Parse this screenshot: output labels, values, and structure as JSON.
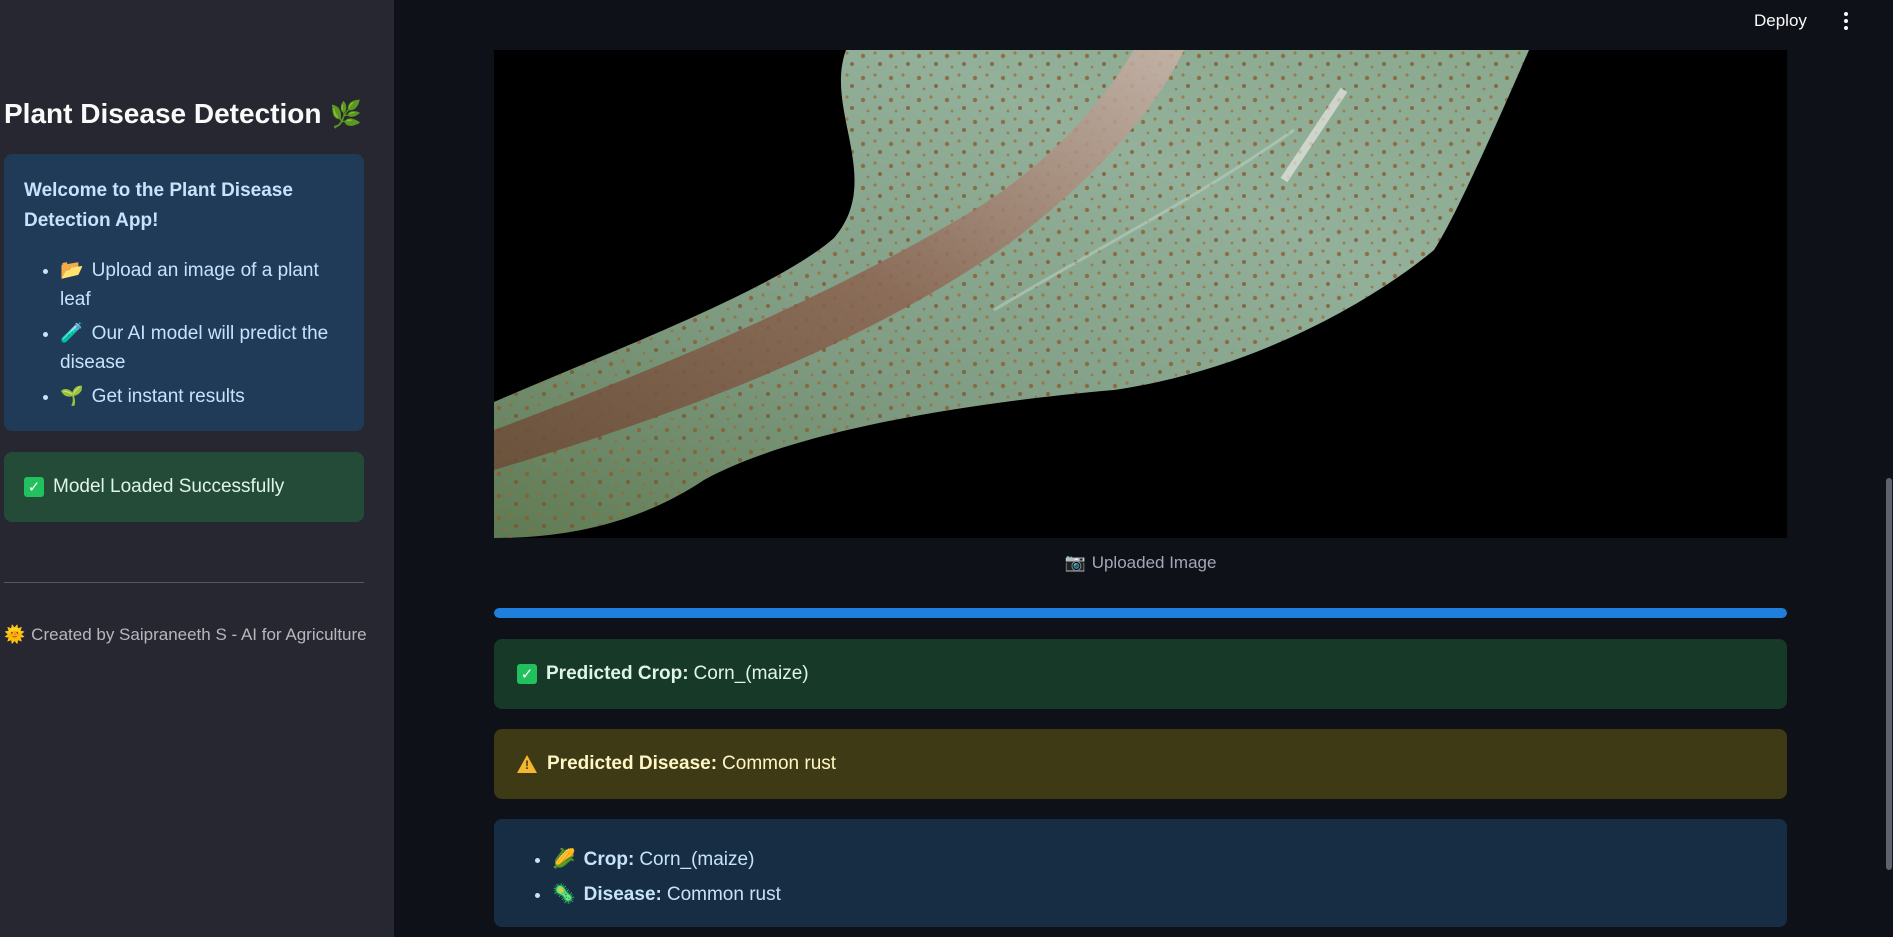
{
  "sidebar": {
    "title": "Plant Disease Detection",
    "title_emoji": "🌿",
    "welcome": {
      "heading": "Welcome to the Plant Disease Detection App!",
      "items": [
        {
          "emoji": "📂",
          "text": "Upload an image of a plant leaf"
        },
        {
          "emoji": "🧪",
          "text": "Our AI model will predict the disease"
        },
        {
          "emoji": "🌱",
          "text": "Get instant results"
        }
      ]
    },
    "model_status": "Model Loaded Successfully",
    "footer_emoji": "🌞",
    "footer": "Created by Saipraneeth S - AI for Agriculture"
  },
  "topbar": {
    "deploy_label": "Deploy",
    "menu_icon": "more-vertical-icon"
  },
  "main": {
    "image_caption_emoji": "📷",
    "image_caption": "Uploaded Image",
    "progress_percent": 100,
    "crop_alert": {
      "label": "Predicted Crop:",
      "value": "Corn_(maize)"
    },
    "disease_alert": {
      "label": "Predicted Disease:",
      "value": "Common rust"
    },
    "summary": [
      {
        "emoji": "🌽",
        "label": "Crop:",
        "value": "Corn_(maize)"
      },
      {
        "emoji": "🦠",
        "label": "Disease:",
        "value": "Common rust"
      }
    ]
  },
  "colors": {
    "background": "#0e1117",
    "sidebar": "#262730",
    "info": "#1f3b57",
    "success": "#173928",
    "warning": "#3e3a16",
    "progress": "#1f7fdc"
  }
}
